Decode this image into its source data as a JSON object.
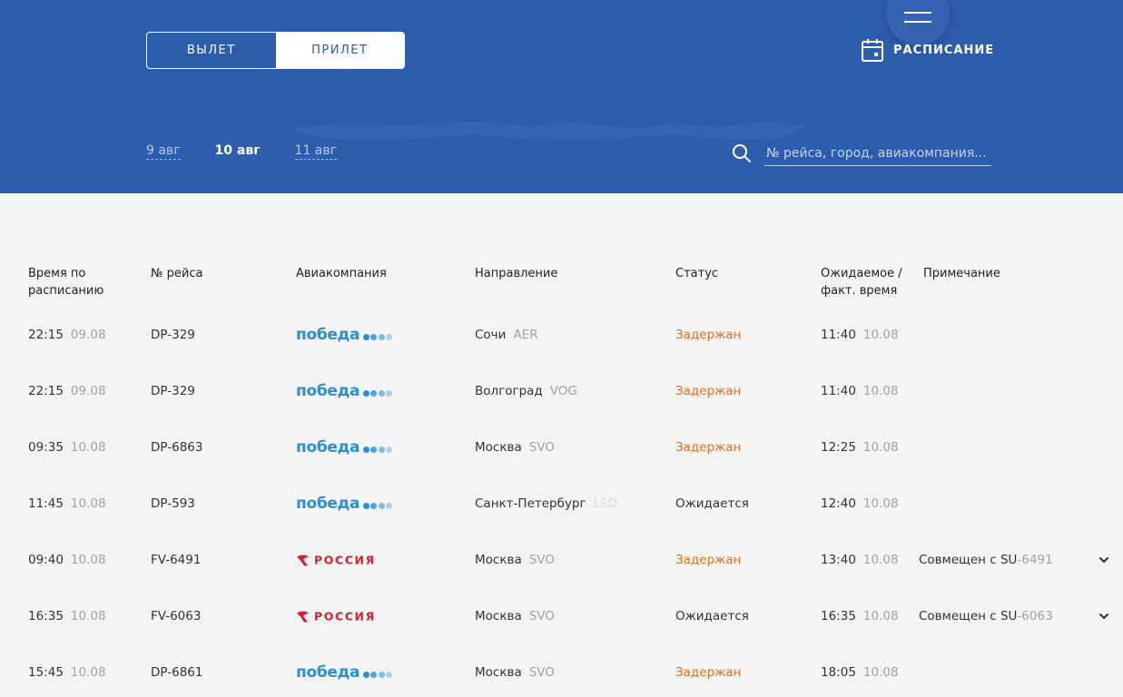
{
  "colors": {
    "header_bg": "#2d5dad",
    "accent_white": "#ffffff",
    "delayed": "#e07020",
    "pobeda_blue": "#2b8fd6",
    "rossiya_red": "#d6212b"
  },
  "tabs": {
    "departure": "ВЫЛЕТ",
    "arrival": "ПРИЛЕТ",
    "active": "arrival"
  },
  "menu": {
    "icon": "hamburger-icon"
  },
  "schedule": {
    "label": "РАСПИСАНИЕ",
    "icon": "calendar-icon"
  },
  "dates": {
    "prev": "9 авг",
    "current": "10 авг",
    "next": "11 авг"
  },
  "search": {
    "placeholder": "№ рейса, город, авиакомпания...",
    "icon": "search-icon"
  },
  "columns": {
    "time_line1": "Время по",
    "time_line2": "расписанию",
    "flight": "№ рейса",
    "airline": "Авиакомпания",
    "direction": "Направление",
    "status": "Статус",
    "expected_line1": "Ожидаемое /",
    "expected_line2": "факт. время",
    "note": "Примечание"
  },
  "airline_logos": {
    "pobeda": {
      "text": "победа",
      "dot_colors": [
        "#2b8fd6",
        "#4fa3e0",
        "#7dbbea",
        "#a9d2f2"
      ]
    },
    "rossiya": {
      "text": "РОССИЯ",
      "icon": "rossiya-wing-icon"
    }
  },
  "flights": [
    {
      "time": "22:15",
      "date": "09.08",
      "flight": "DP-329",
      "airline": "pobeda",
      "city": "Сочи",
      "code": "AER",
      "status": "Задержан",
      "status_type": "delayed",
      "exp_time": "11:40",
      "exp_date": "10.08",
      "note_prefix": "",
      "note_code": "",
      "expandable": false
    },
    {
      "time": "22:15",
      "date": "09.08",
      "flight": "DP-329",
      "airline": "pobeda",
      "city": "Волгоград",
      "code": "VOG",
      "status": "Задержан",
      "status_type": "delayed",
      "exp_time": "11:40",
      "exp_date": "10.08",
      "note_prefix": "",
      "note_code": "",
      "expandable": false
    },
    {
      "time": "09:35",
      "date": "10.08",
      "flight": "DP-6863",
      "airline": "pobeda",
      "city": "Москва",
      "code": "SVO",
      "status": "Задержан",
      "status_type": "delayed",
      "exp_time": "12:25",
      "exp_date": "10.08",
      "note_prefix": "",
      "note_code": "",
      "expandable": false
    },
    {
      "time": "11:45",
      "date": "10.08",
      "flight": "DP-593",
      "airline": "pobeda",
      "city": "Санкт-Петербург",
      "code": "LED",
      "status": "Ожидается",
      "status_type": "expected",
      "exp_time": "12:40",
      "exp_date": "10.08",
      "note_prefix": "",
      "note_code": "",
      "expandable": false
    },
    {
      "time": "09:40",
      "date": "10.08",
      "flight": "FV-6491",
      "airline": "rossiya",
      "city": "Москва",
      "code": "SVO",
      "status": "Задержан",
      "status_type": "delayed",
      "exp_time": "13:40",
      "exp_date": "10.08",
      "note_prefix": "Совмещен с SU",
      "note_code": "-6491",
      "expandable": true
    },
    {
      "time": "16:35",
      "date": "10.08",
      "flight": "FV-6063",
      "airline": "rossiya",
      "city": "Москва",
      "code": "SVO",
      "status": "Ожидается",
      "status_type": "expected",
      "exp_time": "16:35",
      "exp_date": "10.08",
      "note_prefix": "Совмещен с SU",
      "note_code": "-6063",
      "expandable": true
    },
    {
      "time": "15:45",
      "date": "10.08",
      "flight": "DP-6861",
      "airline": "pobeda",
      "city": "Москва",
      "code": "SVO",
      "status": "Задержан",
      "status_type": "delayed",
      "exp_time": "18:05",
      "exp_date": "10.08",
      "note_prefix": "",
      "note_code": "",
      "expandable": false
    }
  ]
}
